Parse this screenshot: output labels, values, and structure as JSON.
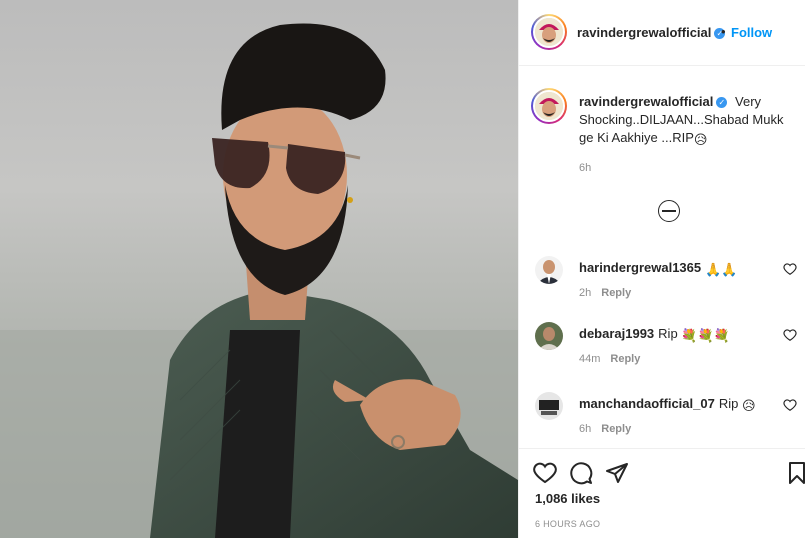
{
  "post_author": {
    "username": "ravindergrewalofficial",
    "follow_label": "Follow",
    "separator": "•"
  },
  "caption": {
    "username": "ravindergrewalofficial",
    "text": "Very Shocking..DILJAAN...Shabad Mukk ge Ki Aakhiye ...RIP",
    "emoji": "😥",
    "time": "6h"
  },
  "comments": [
    {
      "username": "harindergrewal1365",
      "text": "",
      "emoji": "🙏🙏",
      "time": "2h",
      "reply_label": "Reply"
    },
    {
      "username": "debaraj1993",
      "text": "Rip",
      "emoji": "💐💐💐",
      "time": "44m",
      "reply_label": "Reply"
    },
    {
      "username": "manchandaofficial_07",
      "text": "Rip",
      "emoji": "😥",
      "time": "6h",
      "reply_label": "Reply"
    }
  ],
  "actions": {
    "likes": "1,086 likes",
    "ago": "6 HOURS AGO"
  },
  "icons": [
    "like-icon",
    "comment-icon",
    "share-icon",
    "bookmark-icon",
    "comment-like-icon",
    "load-more-icon"
  ],
  "colors": {
    "accent": "#0095f6",
    "verified": "#3897f0",
    "text": "#262626",
    "muted": "#8e8e8e"
  }
}
